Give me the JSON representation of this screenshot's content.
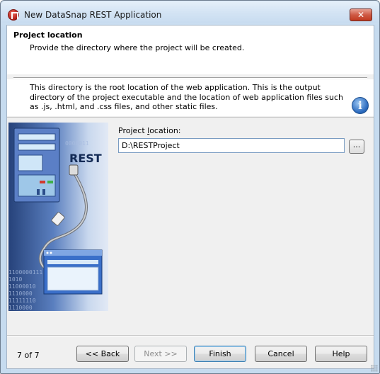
{
  "window": {
    "title": "New DataSnap REST Application",
    "close_label": "✕"
  },
  "header": {
    "title": "Project location",
    "subtitle": "Provide the directory where the project will be created."
  },
  "info": {
    "text": "This directory is the root location of the web application.  This is the output directory of the project executable and the location of web application files such as .js, .html, and .css files, and other static files.",
    "icon": "info-icon"
  },
  "banner": {
    "label": "REST",
    "binary_lines": [
      "0000011",
      "1100000111",
      "1010",
      "11000010",
      "1110000",
      "11111110",
      "1110000"
    ]
  },
  "form": {
    "label_prefix": "Project ",
    "label_accel": "l",
    "label_suffix": "ocation:",
    "path_value": "D:\\RESTProject",
    "browse_label": "..."
  },
  "footer": {
    "page_indicator": "7 of 7",
    "back_label": "<< Back",
    "next_label": "Next >>",
    "finish_label": "Finish",
    "cancel_label": "Cancel",
    "help_label": "Help"
  },
  "colors": {
    "accent": "#3c7fb1",
    "close": "#c1391f",
    "banner_dark": "#26427a"
  }
}
